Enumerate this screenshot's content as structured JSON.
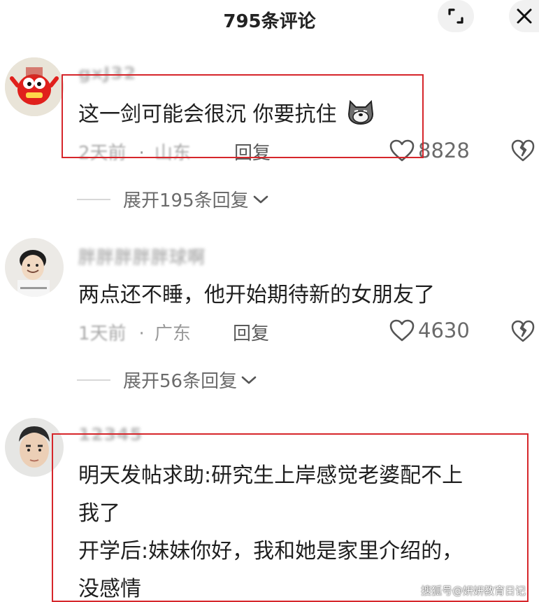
{
  "header": {
    "title": "795条评论"
  },
  "comments": [
    {
      "username": "gxJ32",
      "text": "这一剑可能会很沉 你要抗住",
      "time": "2天前",
      "location": "山东",
      "reply_label": "回复",
      "likes": "8828",
      "expand_label": "展开195条回复"
    },
    {
      "username": "胖胖胖胖胖球啊",
      "text": "两点还不睡，他开始期待新的女朋友了",
      "time": "1天前",
      "location": "广东",
      "reply_label": "回复",
      "likes": "4630",
      "expand_label": "展开56条回复"
    },
    {
      "username": "12345",
      "text_lines": [
        "明天发帖求助:研究生上岸感觉老婆配不上",
        "我了",
        "开学后:妹妹你好，我和她是家里介绍的，",
        "没感情"
      ]
    }
  ],
  "watermark": "搜狐号@妍妍教育日记",
  "colors": {
    "highlight": "#d6262b",
    "text": "#1f1f1f",
    "meta": "#9a9a9a"
  },
  "icons": [
    "expand-icon",
    "close-icon",
    "heart-icon",
    "broken-heart-icon",
    "chevron-down-icon",
    "doge-emoji"
  ]
}
